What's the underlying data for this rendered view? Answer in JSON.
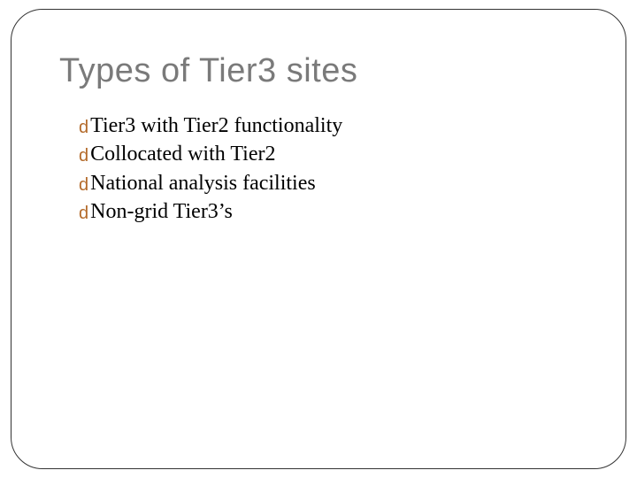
{
  "title": "Types of Tier3 sites",
  "bullets": [
    {
      "icon": "d",
      "text": "Tier3 with Tier2 functionality"
    },
    {
      "icon": "d",
      "text": "Collocated with Tier2"
    },
    {
      "icon": "d",
      "text": "National analysis facilities"
    },
    {
      "icon": "d",
      "text": "Non-grid Tier3’s"
    }
  ]
}
